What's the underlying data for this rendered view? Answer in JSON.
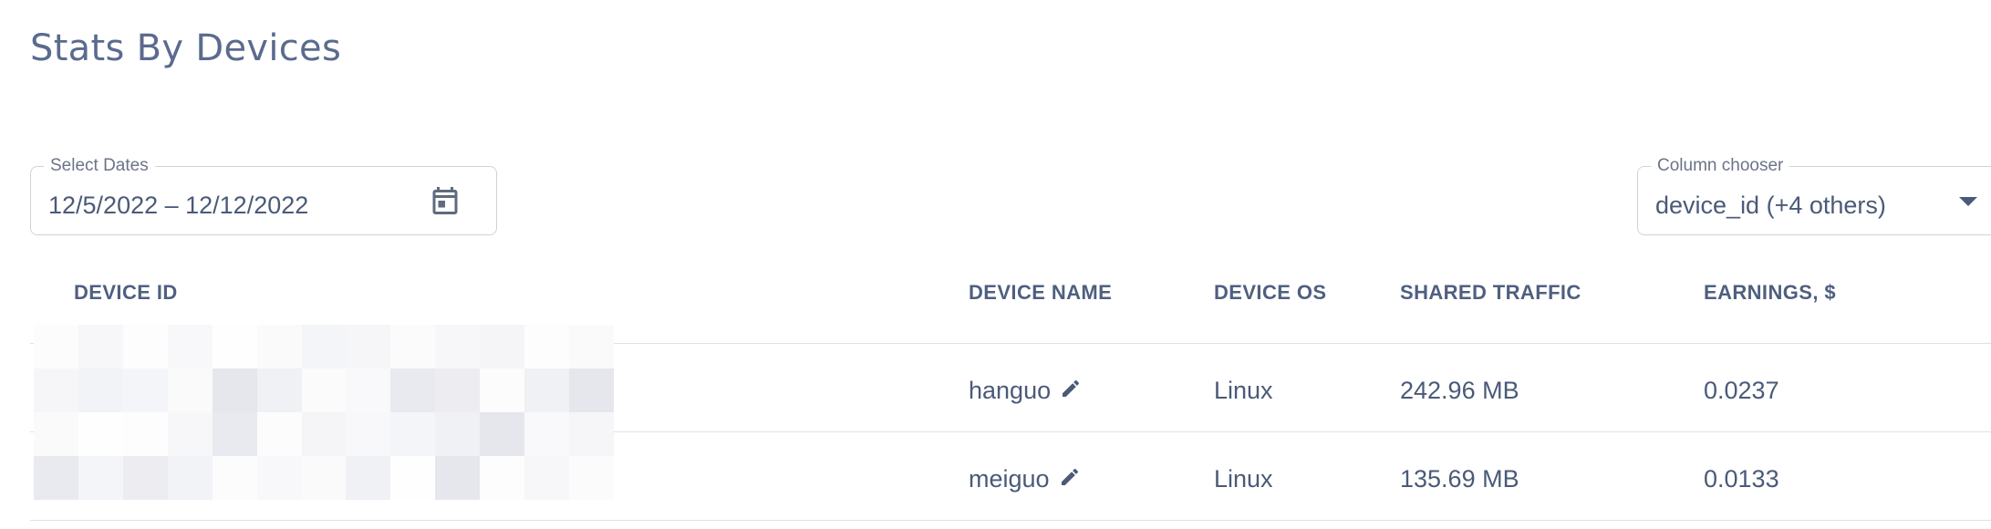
{
  "page": {
    "title": "Stats By Devices"
  },
  "filters": {
    "dates": {
      "legend": "Select Dates",
      "value": "12/5/2022 – 12/12/2022",
      "icon": "calendar-icon"
    },
    "columns": {
      "legend": "Column chooser",
      "value": "device_id (+4 others)",
      "icon": "chevron-down-icon"
    }
  },
  "table": {
    "headers": {
      "device_id": "DEVICE ID",
      "device_name": "DEVICE NAME",
      "device_os": "DEVICE OS",
      "shared_traffic": "SHARED TRAFFIC",
      "earnings": "EARNINGS, $"
    },
    "rows": [
      {
        "device_name": "hanguo",
        "device_os": "Linux",
        "shared_traffic": "242.96 MB",
        "earnings": "0.0237"
      },
      {
        "device_name": "meiguo",
        "device_os": "Linux",
        "shared_traffic": "135.69 MB",
        "earnings": "0.0133"
      }
    ]
  },
  "colors": {
    "title": "#5b6b8e",
    "text": "#4a5a78",
    "border": "#cfd3da",
    "divider": "#dde1e7",
    "icon": "#5f6b7e"
  }
}
